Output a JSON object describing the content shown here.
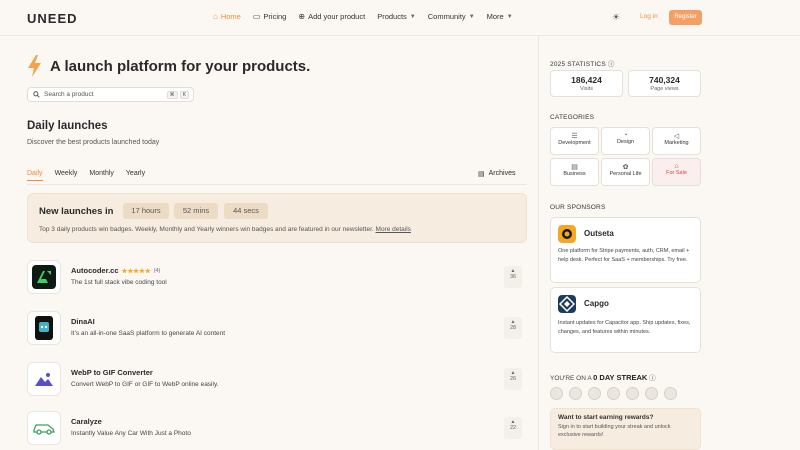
{
  "header": {
    "logo": "UNEED",
    "nav": [
      {
        "label": "Home",
        "icon": "home-icon",
        "glyph": "⌂"
      },
      {
        "label": "Pricing",
        "icon": "tag-icon",
        "glyph": "▭"
      },
      {
        "label": "Add your product",
        "icon": "plus-circle-icon",
        "glyph": "⊕"
      },
      {
        "label": "Products",
        "icon": "",
        "glyph": ""
      },
      {
        "label": "Community",
        "icon": "",
        "glyph": ""
      },
      {
        "label": "More",
        "icon": "",
        "glyph": ""
      }
    ],
    "login": "Log in",
    "register": "Register"
  },
  "hero": {
    "title": "A launch platform for your products."
  },
  "search": {
    "placeholder": "Search a product",
    "kbd1": "⌘",
    "kbd2": "K"
  },
  "daily": {
    "title": "Daily launches",
    "subtitle": "Discover the best products launched today"
  },
  "tabs": [
    "Daily",
    "Weekly",
    "Monthly",
    "Yearly"
  ],
  "archives": "Archives",
  "countdown": {
    "label": "New launches in",
    "hours": "17 hours",
    "mins": "52 mins",
    "secs": "44 secs",
    "desc": "Top 3 daily products win badges. Weekly, Monthly and Yearly winners win badges and are featured in our newsletter.",
    "more": "More details"
  },
  "products": [
    {
      "name": "Autocoder.cc",
      "stars": "★★★★★",
      "rating_count": "(4)",
      "desc": "The 1st full stack vibe coding tool",
      "votes": "36"
    },
    {
      "name": "DinaAI",
      "stars": "",
      "rating_count": "",
      "desc": "It's an all-in-one SaaS platform to generate AI content",
      "votes": "28"
    },
    {
      "name": "WebP to GIF Converter",
      "stars": "",
      "rating_count": "",
      "desc": "Convert WebP to GIF or GIF to WebP online easily.",
      "votes": "26"
    },
    {
      "name": "Caralyze",
      "stars": "",
      "rating_count": "",
      "desc": "Instantly Value Any Car With Just a Photo",
      "votes": "22"
    }
  ],
  "sidebar": {
    "stats_heading": "2025 STATISTICS",
    "stats": [
      {
        "num": "186,424",
        "label": "Visits"
      },
      {
        "num": "740,324",
        "label": "Page views"
      }
    ],
    "categories_heading": "CATEGORIES",
    "categories": [
      {
        "label": "Development",
        "glyph": "☰"
      },
      {
        "label": "Design",
        "glyph": "◔"
      },
      {
        "label": "Marketing",
        "glyph": "◁"
      },
      {
        "label": "Business",
        "glyph": "▤"
      },
      {
        "label": "Personal Life",
        "glyph": "✿"
      },
      {
        "label": "For Sale",
        "glyph": "⌂"
      }
    ],
    "sponsors_heading": "OUR SPONSORS",
    "sponsors": [
      {
        "name": "Outseta",
        "desc": "One platform for Stripe payments, auth, CRM, email + help desk. Perfect for SaaS + memberships. Try free."
      },
      {
        "name": "Capgo",
        "desc": "Instant updates for Capacitor app. Ship updates, fixes, changes, and features within minutes."
      }
    ],
    "streak_prefix": "YOU'RE ON A",
    "streak_value": "0 DAY STREAK",
    "reward_title": "Want to start earning rewards?",
    "reward_desc": "Sign in to start building your streak and unlock exclusive rewards!"
  },
  "colors": {
    "accent": "#f08a3c",
    "for_sale": "#d64545"
  }
}
